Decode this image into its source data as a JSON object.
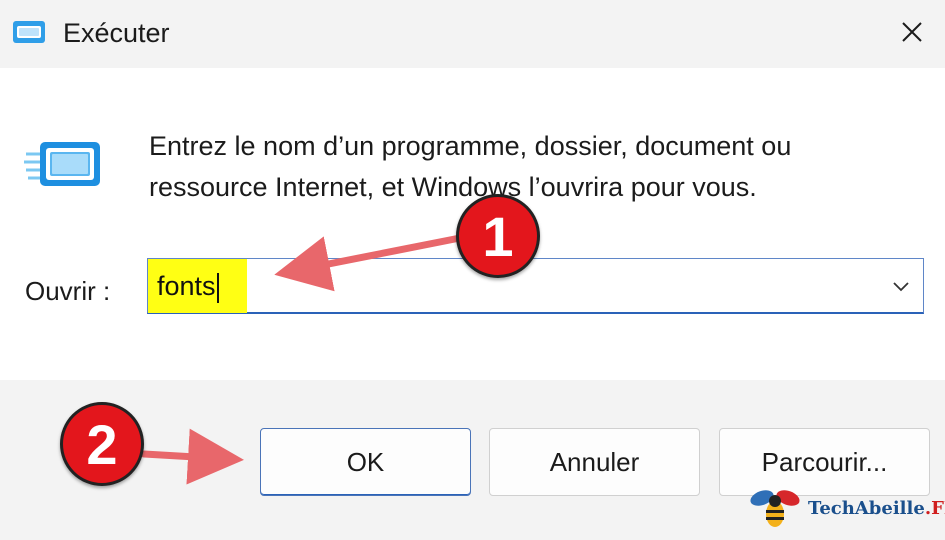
{
  "window": {
    "title": "Exécuter",
    "title_icon": "run-icon",
    "close_icon": "close-icon"
  },
  "dialog": {
    "description": "Entrez le nom d’un programme, dossier, document ou ressource Internet, et Windows l’ouvrira pour vous.",
    "open_label": "Ouvrir :",
    "open_value": "fonts",
    "dropdown_icon": "chevron-down-icon"
  },
  "buttons": {
    "ok": "OK",
    "cancel": "Annuler",
    "browse": "Parcourir..."
  },
  "annotations": {
    "step1": "1",
    "step2": "2",
    "highlight_color": "#ffff14",
    "badge_color": "#e3161c",
    "arrow_color": "#e8676b"
  },
  "watermark": {
    "name": "TechAbeille",
    "suffix": ".FR"
  }
}
